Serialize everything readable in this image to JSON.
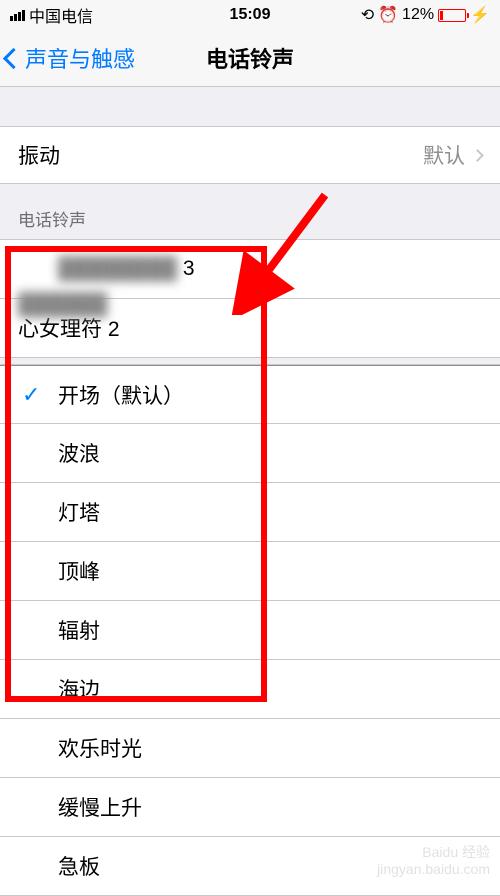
{
  "status_bar": {
    "carrier": "中国电信",
    "time": "15:09",
    "battery_pct": "12%"
  },
  "nav": {
    "back_label": "声音与触感",
    "title": "电话铃声"
  },
  "vibration_row": {
    "label": "振动",
    "value": "默认"
  },
  "section_header": "电话铃声",
  "custom_tones": [
    {
      "label_suffix": "3"
    },
    {
      "label": "心女理符 2"
    }
  ],
  "ringtones": [
    {
      "label": "开场（默认）",
      "selected": true
    },
    {
      "label": "波浪",
      "selected": false
    },
    {
      "label": "灯塔",
      "selected": false
    },
    {
      "label": "顶峰",
      "selected": false
    },
    {
      "label": "辐射",
      "selected": false
    },
    {
      "label": "海边",
      "selected": false
    },
    {
      "label": "欢乐时光",
      "selected": false
    },
    {
      "label": "缓慢上升",
      "selected": false
    },
    {
      "label": "急板",
      "selected": false
    }
  ],
  "watermark": {
    "line1": "Baidu 经验",
    "line2": "jingyan.baidu.com"
  }
}
